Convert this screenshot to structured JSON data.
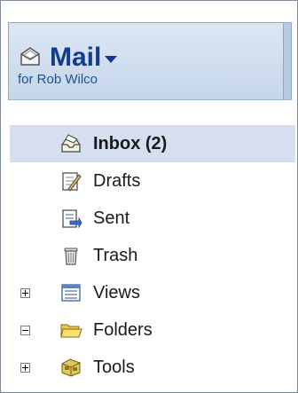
{
  "app": {
    "title": "Mail",
    "subtitle": "for Rob Wilco"
  },
  "nav": [
    {
      "label": "Inbox (2)",
      "icon": "inbox-icon",
      "selected": true
    },
    {
      "label": "Drafts",
      "icon": "drafts-icon"
    },
    {
      "label": "Sent",
      "icon": "sent-icon"
    },
    {
      "label": "Trash",
      "icon": "trash-icon"
    },
    {
      "label": "Views",
      "icon": "views-icon",
      "toggle": "plus"
    },
    {
      "label": "Folders",
      "icon": "folder-icon",
      "toggle": "minus"
    },
    {
      "label": "Tools",
      "icon": "tools-icon",
      "toggle": "plus"
    }
  ],
  "colors": {
    "header_bg": "#c6d6ea",
    "title": "#143c8c",
    "selected_bg": "#d5dff0"
  }
}
